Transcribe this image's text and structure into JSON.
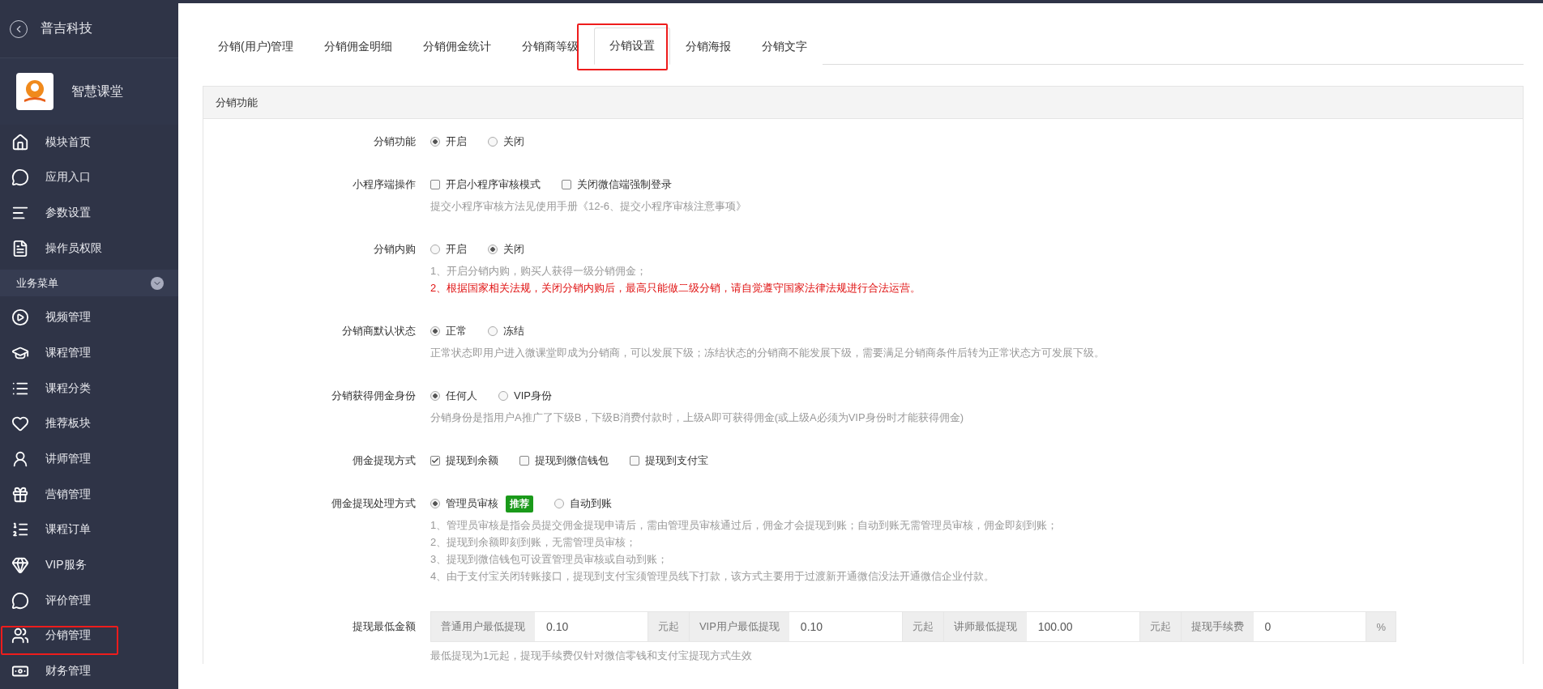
{
  "sidebar": {
    "back_label": "普吉科技",
    "app_name": "智慧课堂",
    "items": [
      {
        "label": "模块首页"
      },
      {
        "label": "应用入口"
      },
      {
        "label": "参数设置"
      },
      {
        "label": "操作员权限"
      }
    ],
    "section": {
      "label": "业务菜单",
      "expanded": true
    },
    "section_items": [
      {
        "label": "视频管理"
      },
      {
        "label": "课程管理"
      },
      {
        "label": "课程分类"
      },
      {
        "label": "推荐板块"
      },
      {
        "label": "讲师管理"
      },
      {
        "label": "营销管理"
      },
      {
        "label": "课程订单"
      },
      {
        "label": "VIP服务"
      },
      {
        "label": "评价管理"
      },
      {
        "label": "分销管理"
      },
      {
        "label": "财务管理"
      }
    ]
  },
  "tabs": [
    {
      "label": "分销(用户)管理",
      "selected": false
    },
    {
      "label": "分销佣金明细",
      "selected": false
    },
    {
      "label": "分销佣金统计",
      "selected": false
    },
    {
      "label": "分销商等级",
      "selected": false
    },
    {
      "label": "分销设置",
      "selected": true
    },
    {
      "label": "分销海报",
      "selected": false
    },
    {
      "label": "分销文字",
      "selected": false
    }
  ],
  "panel": {
    "title": "分销功能",
    "rows": [
      {
        "kind": "radio",
        "label": "分销功能",
        "options": [
          {
            "label": "开启",
            "selected": true
          },
          {
            "label": "关闭",
            "selected": false
          }
        ]
      },
      {
        "kind": "checkbox",
        "label": "小程序端操作",
        "options": [
          {
            "label": "开启小程序审核模式",
            "checked": false
          },
          {
            "label": "关闭微信端强制登录",
            "checked": false
          }
        ],
        "notes": [
          {
            "kind": "hint",
            "text": "提交小程序审核方法见使用手册《12-6、提交小程序审核注意事项》"
          }
        ]
      },
      {
        "kind": "radio",
        "label": "分销内购",
        "options": [
          {
            "label": "开启",
            "selected": false
          },
          {
            "label": "关闭",
            "selected": true
          }
        ],
        "notes": [
          {
            "kind": "hint",
            "text": "1、开启分销内购，购买人获得一级分销佣金；"
          },
          {
            "kind": "warning",
            "text": "2、根据国家相关法规，关闭分销内购后，最高只能做二级分销，请自觉遵守国家法律法规进行合法运营。"
          }
        ]
      },
      {
        "kind": "radio",
        "label": "分销商默认状态",
        "options": [
          {
            "label": "正常",
            "selected": true
          },
          {
            "label": "冻结",
            "selected": false
          }
        ],
        "notes": [
          {
            "kind": "hint",
            "text": "正常状态即用户进入微课堂即成为分销商，可以发展下级；冻结状态的分销商不能发展下级，需要满足分销商条件后转为正常状态方可发展下级。"
          }
        ]
      },
      {
        "kind": "radio",
        "label": "分销获得佣金身份",
        "options": [
          {
            "label": "任何人",
            "selected": true
          },
          {
            "label": "VIP身份",
            "selected": false
          }
        ],
        "notes": [
          {
            "kind": "hint",
            "text": "分销身份是指用户A推广了下级B，下级B消费付款时，上级A即可获得佣金(或上级A必须为VIP身份时才能获得佣金)"
          }
        ]
      },
      {
        "kind": "checkbox",
        "label": "佣金提现方式",
        "options": [
          {
            "label": "提现到余额",
            "checked": true
          },
          {
            "label": "提现到微信钱包",
            "checked": false
          },
          {
            "label": "提现到支付宝",
            "checked": false
          }
        ]
      },
      {
        "kind": "radio",
        "label": "佣金提现处理方式",
        "options": [
          {
            "label": "管理员审核",
            "selected": true,
            "badge": "推荐"
          },
          {
            "label": "自动到账",
            "selected": false
          }
        ],
        "notes": [
          {
            "kind": "hint",
            "text": "1、管理员审核是指会员提交佣金提现申请后，需由管理员审核通过后，佣金才会提现到账；自动到账无需管理员审核，佣金即刻到账；"
          },
          {
            "kind": "hint",
            "text": "2、提现到余额即刻到账，无需管理员审核；"
          },
          {
            "kind": "hint",
            "text": "3、提现到微信钱包可设置管理员审核或自动到账；"
          },
          {
            "kind": "hint",
            "text": "4、由于支付宝关闭转账接口，提现到支付宝须管理员线下打款，该方式主要用于过渡新开通微信没法开通微信企业付款。"
          }
        ]
      },
      {
        "kind": "inputs",
        "label": "提现最低金额",
        "groups": [
          {
            "addon": "普通用户最低提现",
            "value": "0.10",
            "unit": "元起"
          },
          {
            "addon": "VIP用户最低提现",
            "value": "0.10",
            "unit": "元起"
          },
          {
            "addon": "讲师最低提现",
            "value": "100.00",
            "unit": "元起"
          },
          {
            "addon": "提现手续费",
            "value": "0",
            "unit": "%"
          }
        ],
        "notes": [
          {
            "kind": "hint",
            "text": "最低提现为1元起，提现手续费仅针对微信零钱和支付宝提现方式生效"
          }
        ]
      }
    ]
  }
}
